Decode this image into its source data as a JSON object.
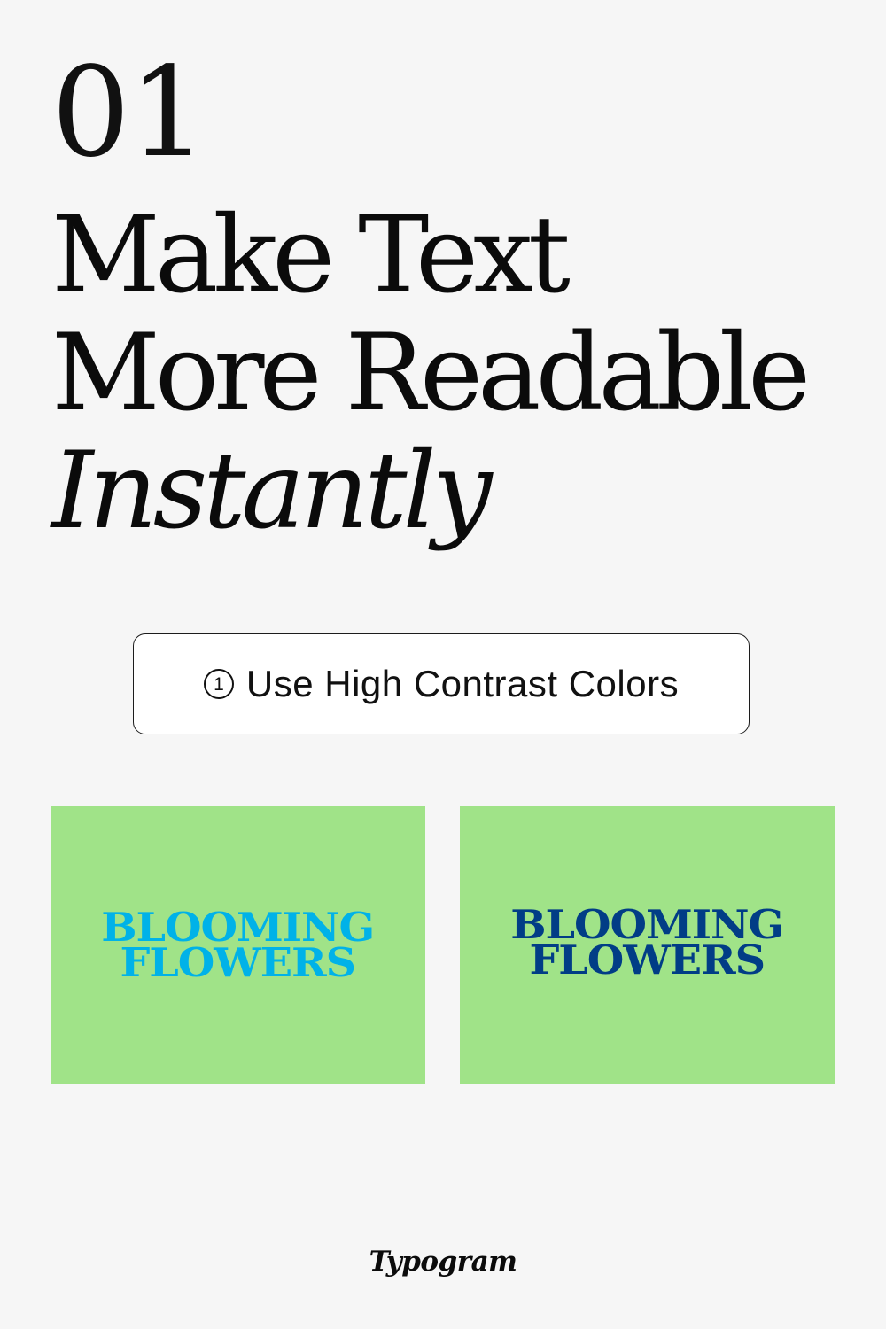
{
  "step": {
    "number": "01"
  },
  "headline": {
    "line1": "Make Text",
    "line2": "More Readable",
    "line3": "Instantly"
  },
  "tip": {
    "number": "1",
    "label": "Use High Contrast Colors"
  },
  "examples": [
    {
      "line1": "BLOOMING",
      "line2": "FLOWERS",
      "background": "#a0e388",
      "text_color": "#00b2e8"
    },
    {
      "line1": "BLOOMING",
      "line2": "FLOWERS",
      "background": "#a0e388",
      "text_color": "#013d86"
    }
  ],
  "brand": {
    "name": "Typogram"
  },
  "colors": {
    "page_background": "#f6f6f6",
    "text": "#0b0b0b"
  }
}
